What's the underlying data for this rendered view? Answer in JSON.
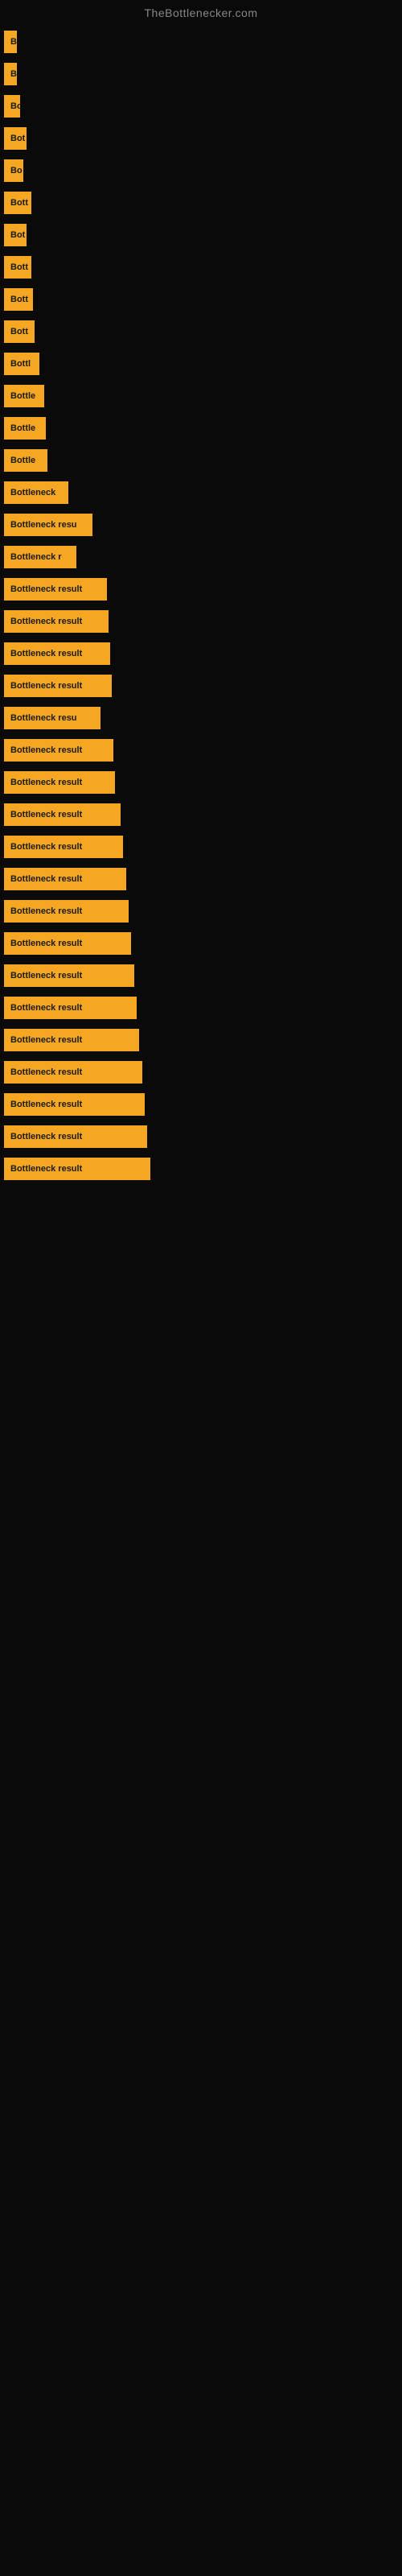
{
  "header": {
    "site_title": "TheBottlenecker.com"
  },
  "items": [
    {
      "label": "B",
      "width": 14
    },
    {
      "label": "B",
      "width": 16
    },
    {
      "label": "Bo",
      "width": 20
    },
    {
      "label": "Bot",
      "width": 28
    },
    {
      "label": "Bo",
      "width": 24
    },
    {
      "label": "Bott",
      "width": 34
    },
    {
      "label": "Bot",
      "width": 28
    },
    {
      "label": "Bott",
      "width": 34
    },
    {
      "label": "Bott",
      "width": 36
    },
    {
      "label": "Bott",
      "width": 38
    },
    {
      "label": "Bottl",
      "width": 44
    },
    {
      "label": "Bottle",
      "width": 50
    },
    {
      "label": "Bottle",
      "width": 52
    },
    {
      "label": "Bottle",
      "width": 54
    },
    {
      "label": "Bottleneck",
      "width": 80
    },
    {
      "label": "Bottleneck resu",
      "width": 110
    },
    {
      "label": "Bottleneck r",
      "width": 90
    },
    {
      "label": "Bottleneck result",
      "width": 128
    },
    {
      "label": "Bottleneck result",
      "width": 130
    },
    {
      "label": "Bottleneck result",
      "width": 132
    },
    {
      "label": "Bottleneck result",
      "width": 134
    },
    {
      "label": "Bottleneck resu",
      "width": 120
    },
    {
      "label": "Bottleneck result",
      "width": 136
    },
    {
      "label": "Bottleneck result",
      "width": 138
    },
    {
      "label": "Bottleneck result",
      "width": 145
    },
    {
      "label": "Bottleneck result",
      "width": 148
    },
    {
      "label": "Bottleneck result",
      "width": 152
    },
    {
      "label": "Bottleneck result",
      "width": 155
    },
    {
      "label": "Bottleneck result",
      "width": 158
    },
    {
      "label": "Bottleneck result",
      "width": 162
    },
    {
      "label": "Bottleneck result",
      "width": 165
    },
    {
      "label": "Bottleneck result",
      "width": 168
    },
    {
      "label": "Bottleneck result",
      "width": 172
    },
    {
      "label": "Bottleneck result",
      "width": 175
    },
    {
      "label": "Bottleneck result",
      "width": 178
    },
    {
      "label": "Bottleneck result",
      "width": 182
    }
  ]
}
